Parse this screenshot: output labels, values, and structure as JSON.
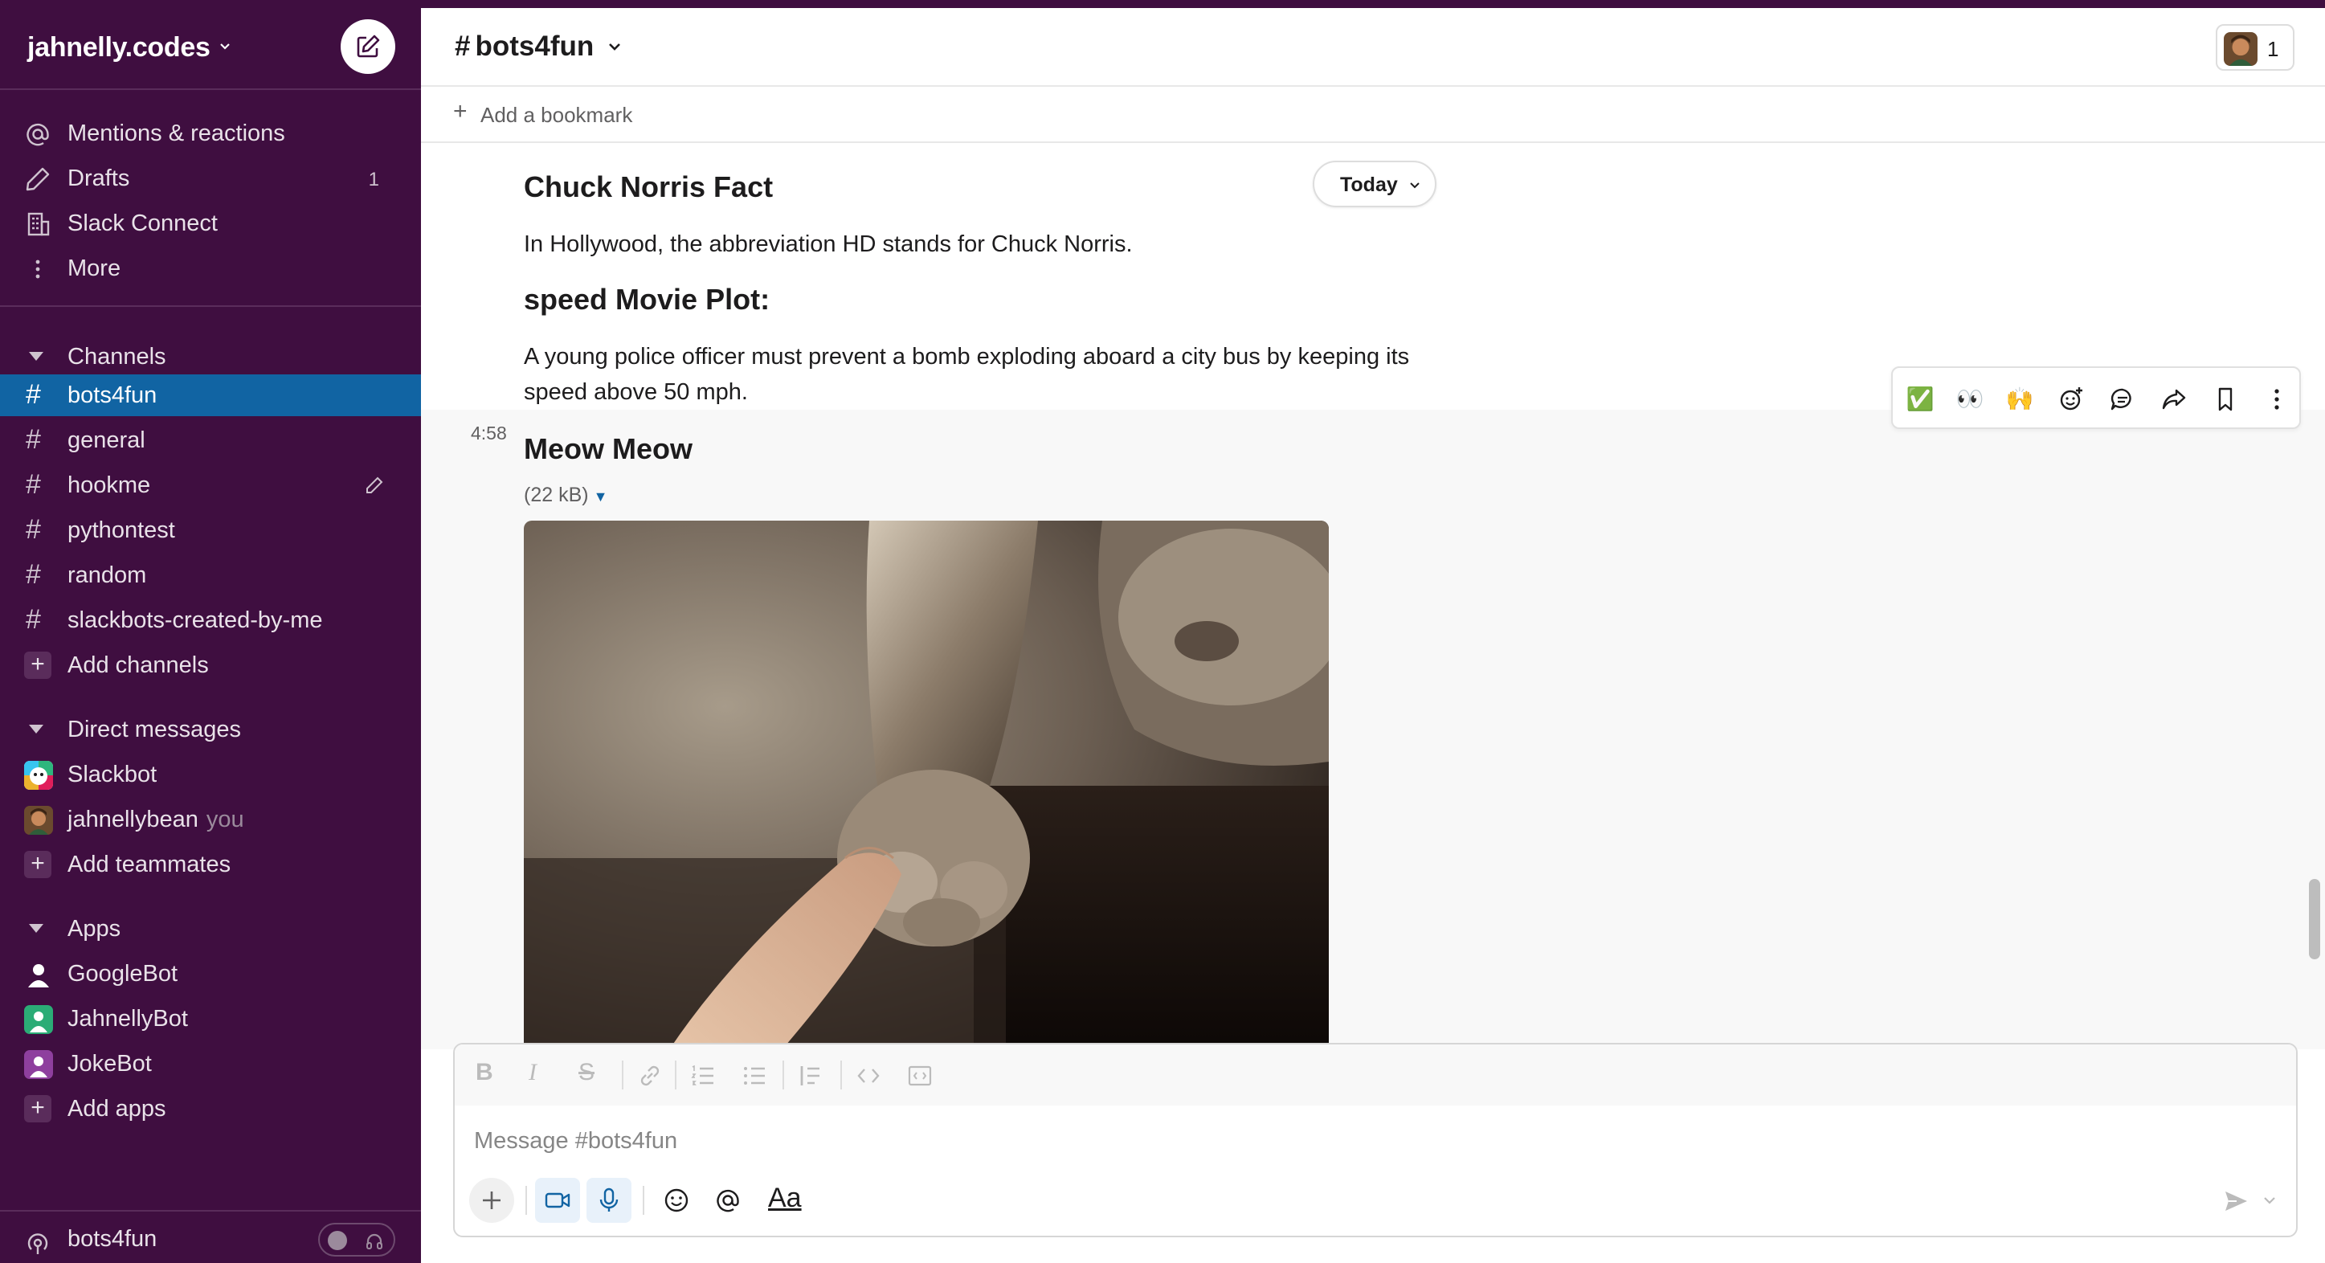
{
  "workspace": {
    "name": "jahnelly.codes"
  },
  "sidebar": {
    "top_items": [
      {
        "label": "Mentions & reactions",
        "icon": "at-icon"
      },
      {
        "label": "Drafts",
        "icon": "pencil-icon",
        "count": "1"
      },
      {
        "label": "Slack Connect",
        "icon": "building-icon"
      },
      {
        "label": "More",
        "icon": "more-vertical-icon"
      }
    ],
    "channels_header": "Channels",
    "channels": [
      "bots4fun",
      "general",
      "hookme",
      "pythontest",
      "random",
      "slackbots-created-by-me"
    ],
    "active_channel": "bots4fun",
    "add_channels": "Add channels",
    "dms_header": "Direct messages",
    "dms": [
      {
        "label": "Slackbot",
        "suffix": ""
      },
      {
        "label": "jahnellybean",
        "suffix": "you"
      }
    ],
    "add_teammates": "Add teammates",
    "apps_header": "Apps",
    "apps": [
      "GoogleBot",
      "JahnellyBot",
      "JokeBot"
    ],
    "add_apps": "Add apps",
    "huddle_label": "bots4fun"
  },
  "channel_header": {
    "hash": "#",
    "name": "bots4fun",
    "member_count": "1",
    "add_bookmark": "Add a bookmark"
  },
  "messages": {
    "date_divider": "Today",
    "chuck_title": "Chuck Norris Fact",
    "chuck_text": "In Hollywood, the abbreviation HD stands for Chuck Norris.",
    "movie_title": "speed Movie Plot:",
    "movie_text_line1": "A young police officer must prevent a bomb exploding aboard a city bus by keeping its",
    "movie_text_line2": "speed above 50 mph.",
    "meow_time": "4:58",
    "meow_title": "Meow Meow",
    "file_size": "(22 kB)",
    "image_subject": "cat-paw-on-finger-photo"
  },
  "message_actions": [
    {
      "name": "check-mark-reaction",
      "glyph": "✅"
    },
    {
      "name": "eyes-reaction",
      "glyph": "👀"
    },
    {
      "name": "raised-hands-reaction",
      "glyph": "🙌"
    },
    {
      "name": "add-reaction",
      "icon": "emoji-plus-icon"
    },
    {
      "name": "reply-in-thread",
      "icon": "thread-icon"
    },
    {
      "name": "share-message",
      "icon": "forward-icon"
    },
    {
      "name": "save-message",
      "icon": "bookmark-icon"
    },
    {
      "name": "more-actions",
      "icon": "more-vertical-icon"
    }
  ],
  "composer": {
    "placeholder": "Message #bots4fun",
    "format_label": "Aa"
  },
  "colors": {
    "sidebar_bg": "#3f0e40",
    "active_channel_bg": "#1164a3",
    "text": "#1d1c1d"
  }
}
